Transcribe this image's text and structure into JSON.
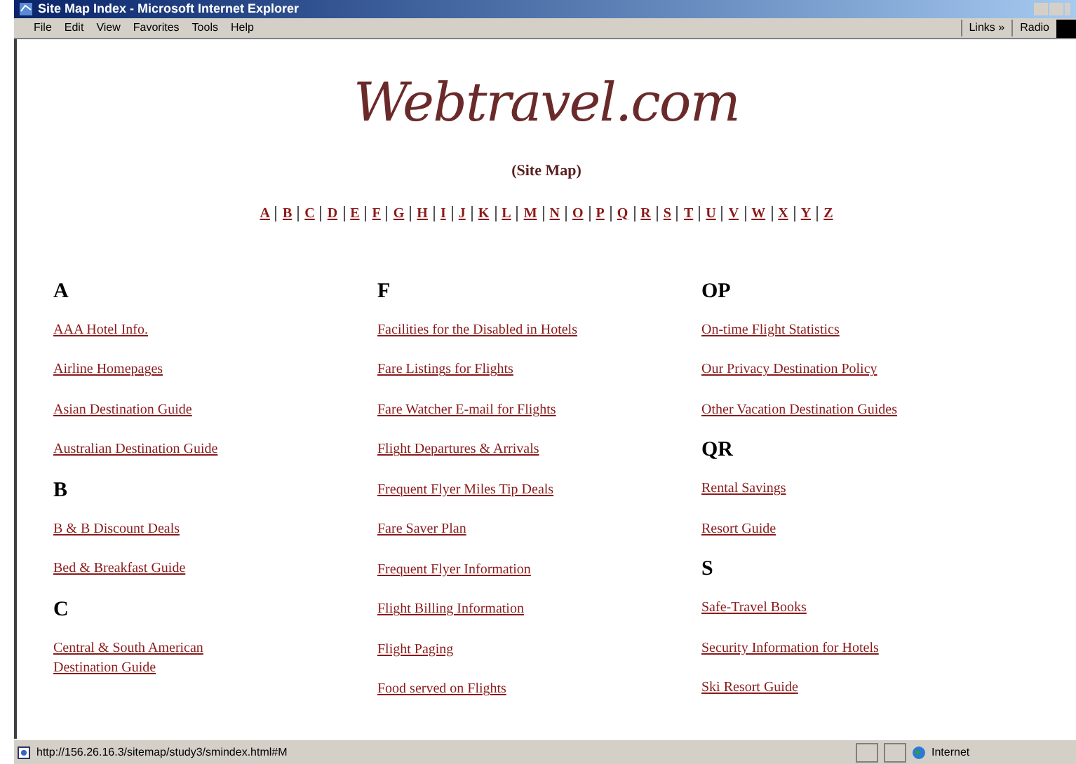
{
  "window": {
    "title": "Site Map Index - Microsoft Internet Explorer"
  },
  "menu": [
    "File",
    "Edit",
    "View",
    "Favorites",
    "Tools",
    "Help"
  ],
  "toolbar_right": [
    "Links »",
    "Radio"
  ],
  "page": {
    "logo": "Webtravel.com",
    "subtitle": "(Site Map)",
    "letters": [
      "A",
      "B",
      "C",
      "D",
      "E",
      "F",
      "G",
      "H",
      "I",
      "J",
      "K",
      "L",
      "M",
      "N",
      "O",
      "P",
      "Q",
      "R",
      "S",
      "T",
      "U",
      "V",
      "W",
      "X",
      "Y",
      "Z"
    ],
    "columns": [
      [
        {
          "heading": "A",
          "links": [
            "AAA Hotel Info.",
            "Airline Homepages",
            "Asian Destination Guide",
            "Australian Destination Guide"
          ]
        },
        {
          "heading": "B",
          "links": [
            "B & B Discount Deals",
            "Bed & Breakfast Guide"
          ]
        },
        {
          "heading": "C",
          "links": [
            "Central & South American Destination Guide"
          ]
        }
      ],
      [
        {
          "heading": "F",
          "links": [
            "Facilities for the Disabled in Hotels",
            "Fare Listings for Flights",
            "Fare Watcher E-mail for Flights",
            "Flight Departures & Arrivals",
            "Frequent Flyer Miles Tip Deals",
            "Fare Saver Plan",
            "Frequent Flyer Information",
            "Flight Billing Information",
            "Flight Paging",
            "Food served on Flights"
          ]
        }
      ],
      [
        {
          "heading": "OP",
          "links": [
            "On-time Flight Statistics",
            "Our Privacy Destination Policy",
            "Other Vacation Destination Guides"
          ]
        },
        {
          "heading": "QR",
          "links": [
            "Rental Savings",
            "Resort Guide"
          ]
        },
        {
          "heading": "S",
          "links": [
            "Safe-Travel Books",
            "Security Information for Hotels",
            "Ski Resort Guide"
          ]
        }
      ]
    ]
  },
  "status_bar": {
    "url": "http://156.26.16.3/sitemap/study3/smindex.html#M",
    "zone": "Internet"
  }
}
